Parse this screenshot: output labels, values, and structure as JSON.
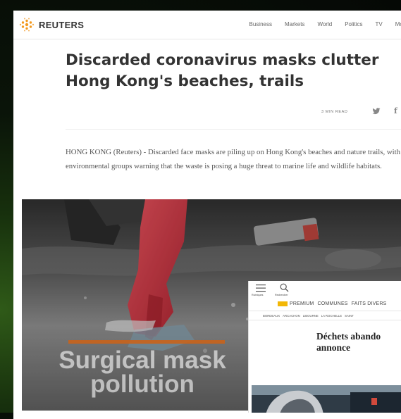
{
  "reuters": {
    "brand": "REUTERS",
    "nav": [
      "Business",
      "Markets",
      "World",
      "Politics",
      "TV",
      "More"
    ],
    "headline": "Discarded coronavirus masks clutter Hong Kong's beaches, trails",
    "read_time": "3 MIN READ",
    "share": {
      "twitter": "twitter-icon",
      "facebook_glyph": "f"
    },
    "lead": "HONG KONG (Reuters) - Discarded face masks are piling up on Hong Kong's beaches and nature trails, with environmental groups warning that the waste is posing a huge threat to marine life and wildlife habitats.",
    "video_caption": "Surgical mask\npollution",
    "colors": {
      "caption_bar": "#c9631b",
      "glove": "#c8323c",
      "logo_orange": "#f39a1f"
    }
  },
  "sudouest": {
    "menu_label": "Rubriques",
    "search_label": "Rechercher",
    "premium_label": "PREMIUM",
    "nav": [
      "COMMUNES",
      "FAITS DIVERS"
    ],
    "cities": [
      "BORDEAUX",
      "ARCACHON",
      "LIBOURNE",
      "LA ROCHELLE",
      "SAINT"
    ],
    "headline": "Déchets abando\nannonce",
    "colors": {
      "premium_badge": "#f2b707"
    }
  }
}
